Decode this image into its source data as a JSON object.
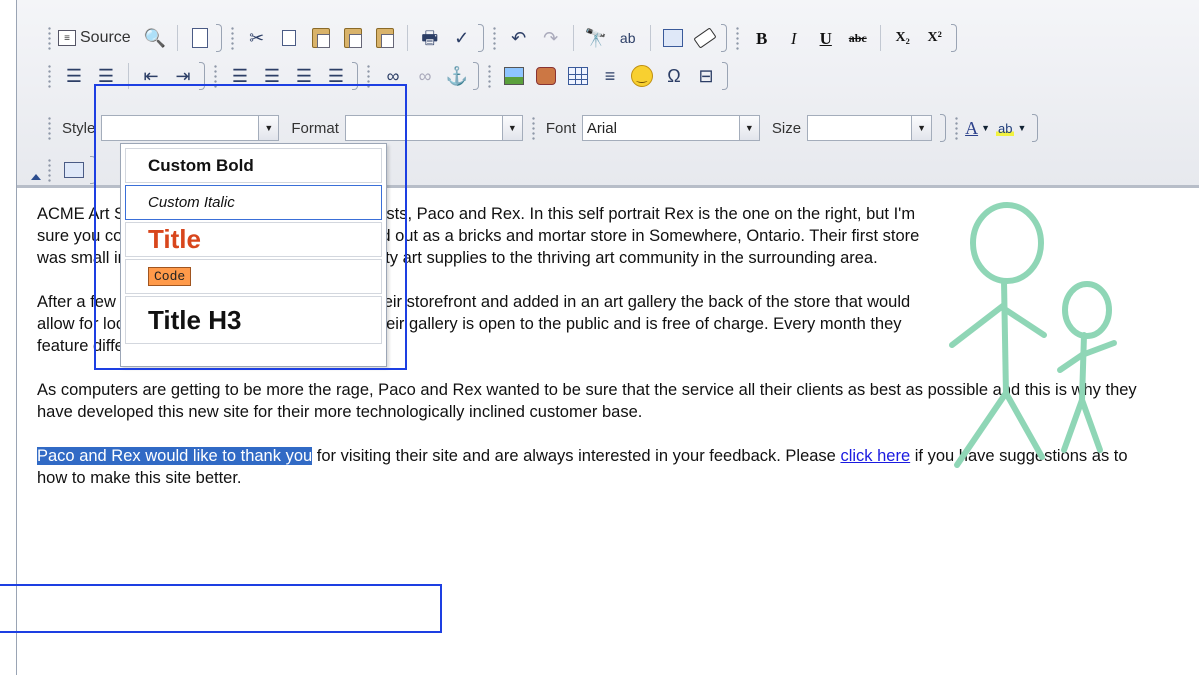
{
  "toolbar": {
    "source_label": "Source",
    "bold_label": "B",
    "italic_label": "I",
    "underline_label": "U",
    "strike_label": "abc",
    "subscript_label": "X₂",
    "superscript_label": "X²",
    "style_label": "Style",
    "style_value": "",
    "format_label": "Format",
    "format_value": "",
    "font_label": "Font",
    "font_value": "Arial",
    "size_label": "Size",
    "size_value": "",
    "text_color_label": "A",
    "bg_color_label": "ab"
  },
  "style_dropdown": {
    "options": [
      {
        "label": "Custom Bold",
        "highlighted": false
      },
      {
        "label": "Custom Italic",
        "highlighted": true
      },
      {
        "label": "Title",
        "highlighted": false
      },
      {
        "label": "Code",
        "highlighted": false
      },
      {
        "label": "Title H3",
        "highlighted": false
      }
    ]
  },
  "content": {
    "p1": "ACME Art Supplies is the creation of 2 great artists, Paco and Rex.  In this self portrait Rex is the one on the right, but I'm sure you couldn't tell.  ACME Art Supplies started out as a bricks and mortar store in Somewhere, Ontario.  Their first store was small in size but allowed them to offer quality art supplies to the thriving art community in the surrounding area.",
    "p2": "After a few years in business, they expanded their storefront and added in an art gallery the back of the store that would allow for local artists to showcase their work.  Their gallery is open to the public and is free of charge.  Every month they feature different local artistans.",
    "p3": "As computers are getting to be more the rage, Paco and Rex wanted to be sure that the service all their clients as best as possible and this is why they have developed this new site for their more technologically inclined customer base.",
    "p4_selected": "Paco and Rex would like to thank you",
    "p4_rest": " for visiting their site and are always interested in your feedback.  Please ",
    "p4_link": "click here",
    "p4_end": " if you have suggestions as to how to make this site better."
  },
  "colors": {
    "accent": "#316ac5",
    "annotation": "#1d3fe2",
    "title_style": "#d8461c",
    "code_style": "#ff9a4a",
    "figure": "#8fd6b6"
  }
}
